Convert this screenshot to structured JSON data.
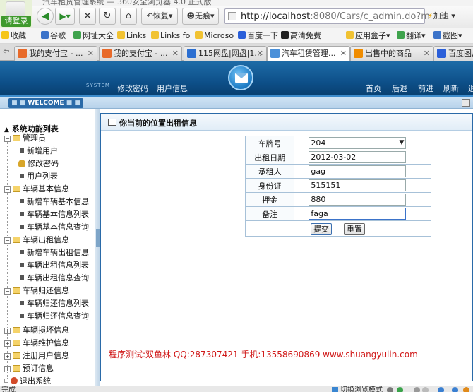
{
  "browser": {
    "window_title_fragment": "汽车租赁管理系统 — 360安全浏览器 4.0 正式版",
    "login_label": "请登录",
    "restore_label": "恢复",
    "noimage_label": "无痕",
    "url_host": "http://localhost",
    "url_rest": ":8080/Cars/c_admin.do?m",
    "accel_label": "加速",
    "bookmarks": [
      {
        "label": "收藏",
        "icon": "star-icon"
      },
      {
        "label": "谷歌",
        "icon": "google-icon"
      },
      {
        "label": "网址大全",
        "icon": "globe-icon"
      },
      {
        "label": "Links",
        "icon": "folder-icon"
      },
      {
        "label": "Links fo",
        "icon": "folder-icon"
      },
      {
        "label": "Microso",
        "icon": "folder-icon"
      },
      {
        "label": "百度一下",
        "icon": "baidu-paw-icon"
      },
      {
        "label": "高清免费",
        "icon": "m-logo-icon"
      },
      {
        "label": "应用盒子",
        "icon": "apps-icon"
      },
      {
        "label": "翻译",
        "icon": "translate-icon"
      },
      {
        "label": "截图",
        "icon": "screenshot-icon"
      }
    ],
    "tabs": [
      {
        "label": "我的支付宝 - ...",
        "icon": "alipay-icon",
        "active": false
      },
      {
        "label": "我的支付宝 - ...",
        "icon": "alipay-icon",
        "active": false
      },
      {
        "label": "115网盘|网盘|1...",
        "icon": "115-icon",
        "active": false
      },
      {
        "label": "汽车租赁管理...",
        "icon": "ie-page-icon",
        "active": true
      },
      {
        "label": "出售中的商品",
        "icon": "taobao-icon",
        "active": false
      },
      {
        "label": "百度图片",
        "icon": "baidu-paw-icon",
        "active": false
      }
    ],
    "status_text": "完成",
    "status_mode": "切换浏览模式"
  },
  "header": {
    "system_label": "SYSTEM",
    "links_left": [
      "修改密码",
      "用户信息"
    ],
    "links_right": [
      "首页",
      "后退",
      "前进",
      "刷新",
      "退"
    ]
  },
  "welcome": "WELCOME",
  "sidebar": {
    "root": "系统功能列表",
    "groups": [
      {
        "label": "管理员",
        "expanded": true,
        "items": [
          "新增用户",
          "修改密码",
          "用户列表"
        ]
      },
      {
        "label": "车辆基本信息",
        "expanded": true,
        "items": [
          "新增车辆基本信息",
          "车辆基本信息列表",
          "车辆基本信息查询"
        ]
      },
      {
        "label": "车辆出租信息",
        "expanded": true,
        "items": [
          "新增车辆出租信息",
          "车辆出租信息列表",
          "车辆出租信息查询"
        ]
      },
      {
        "label": "车辆归还信息",
        "expanded": true,
        "items": [
          "车辆归还信息列表",
          "车辆归还信息查询"
        ]
      },
      {
        "label": "车辆损坏信息",
        "expanded": false,
        "items": []
      },
      {
        "label": "车辆维护信息",
        "expanded": false,
        "items": []
      },
      {
        "label": "注册用户信息",
        "expanded": false,
        "items": []
      },
      {
        "label": "预订信息",
        "expanded": false,
        "items": []
      }
    ],
    "exit_label": "退出系统"
  },
  "main": {
    "location_title": "你当前的位置出租信息",
    "form": {
      "plate": {
        "label": "车牌号",
        "value": "204"
      },
      "rent_date": {
        "label": "出租日期",
        "value": "2012-03-02"
      },
      "renter": {
        "label": "承租人",
        "value": "gag"
      },
      "id_card": {
        "label": "身份证",
        "value": "515151"
      },
      "deposit": {
        "label": "押金",
        "value": "880"
      },
      "note": {
        "label": "备注",
        "value": "faga"
      }
    },
    "submit_label": "提交",
    "reset_label": "重置",
    "credits": "程序测试:双鱼林 QQ:287307421 手机:13558690869 www.shuangyulin.com"
  }
}
